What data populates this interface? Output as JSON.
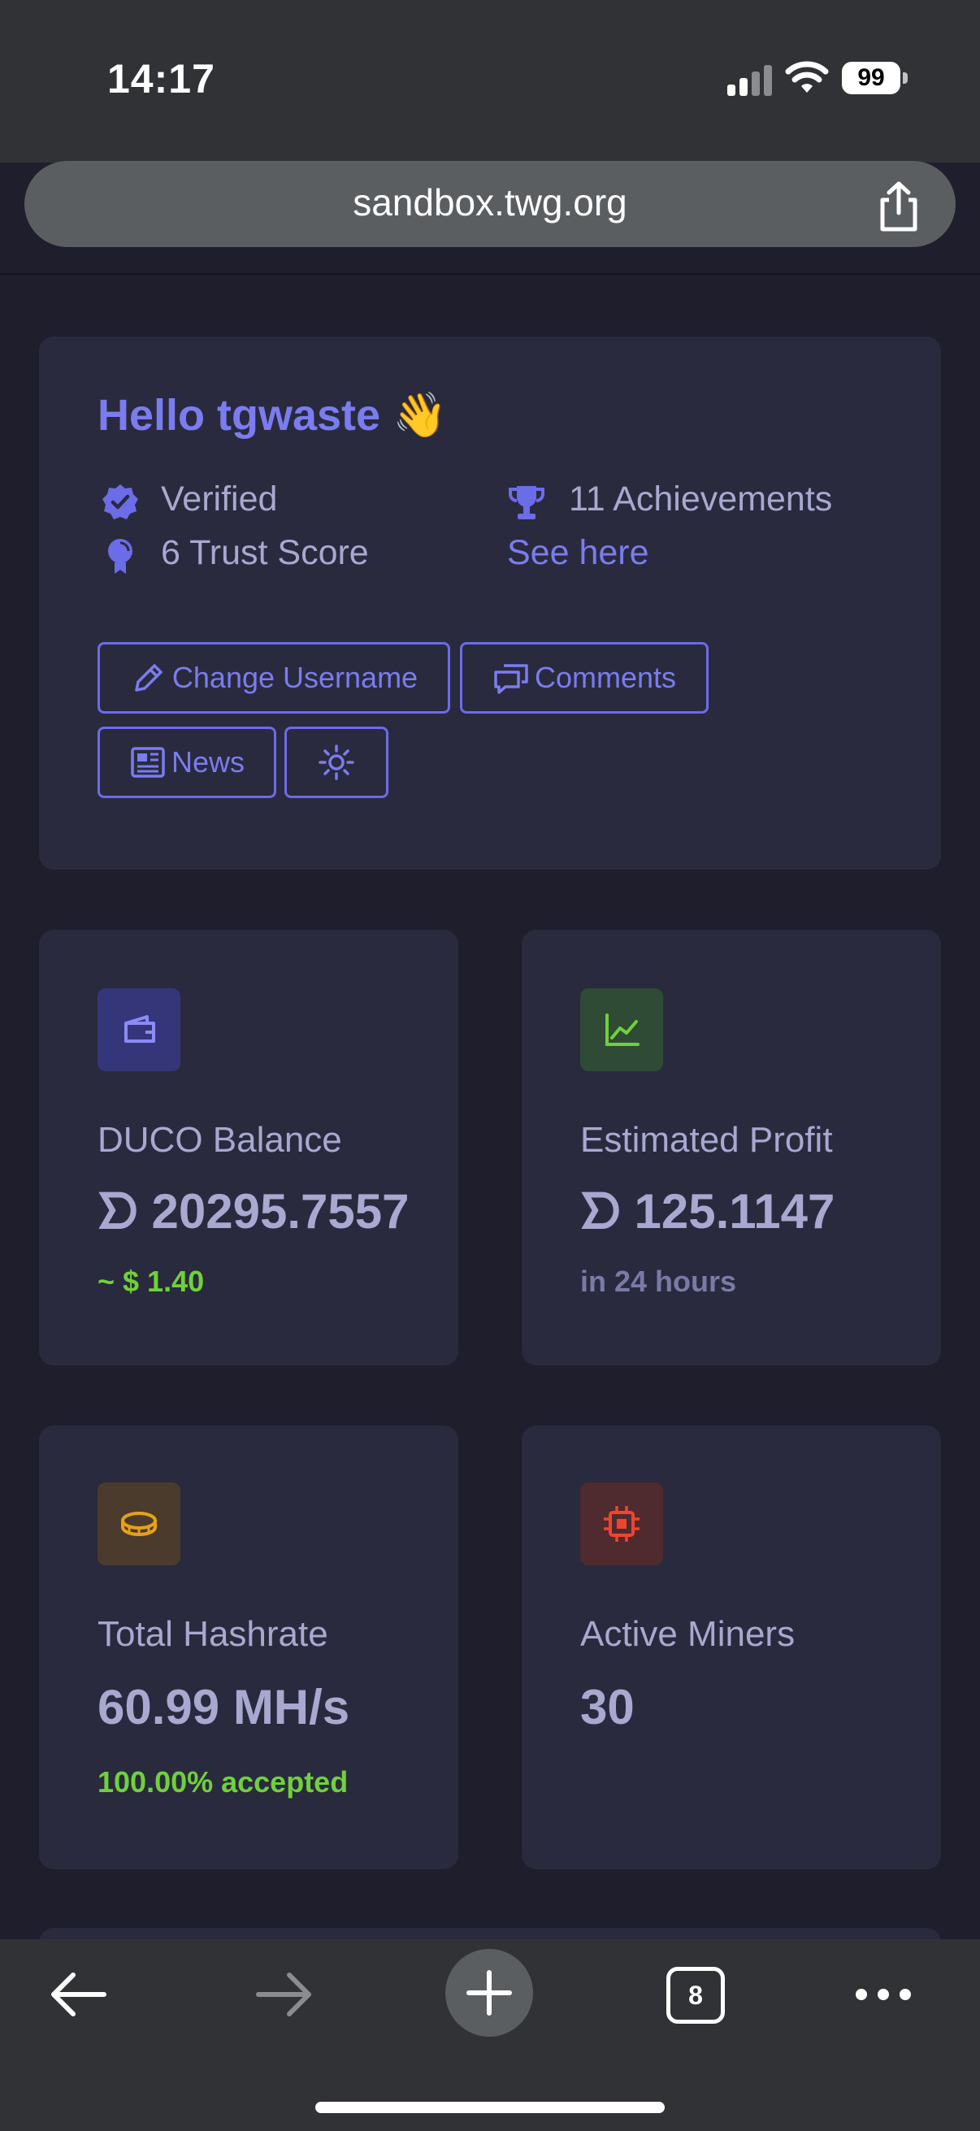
{
  "status_bar": {
    "time": "14:17",
    "battery": "99"
  },
  "browser": {
    "url": "sandbox.twg.org",
    "tab_count": "8"
  },
  "welcome": {
    "greeting": "Hello tgwaste",
    "wave_emoji": "👋",
    "verified": "Verified",
    "trust_score": "6 Trust Score",
    "achievements": "11 Achievements",
    "see_here": "See here",
    "buttons": {
      "change_username": "Change Username",
      "comments": "Comments",
      "news": "News"
    }
  },
  "tiles": {
    "balance": {
      "label": "DUCO Balance",
      "value": "ᗤ 20295.7557",
      "sub": "~ $ 1.40"
    },
    "profit": {
      "label": "Estimated Profit",
      "value": "ᗤ 125.1147",
      "sub": "in 24 hours"
    },
    "hashrate": {
      "label": "Total Hashrate",
      "value": "60.99 MH/s",
      "sub": "100.00% accepted"
    },
    "miners": {
      "label": "Active Miners",
      "value": "30"
    }
  },
  "colors": {
    "accent": "#7b7cf0",
    "green": "#6fd13b",
    "orange": "#e8a019",
    "red": "#f0452d"
  },
  "icons": [
    "share-icon",
    "verified-badge-icon",
    "trust-score-icon",
    "trophy-icon",
    "pencil-icon",
    "comments-icon",
    "news-icon",
    "sun-icon",
    "wallet-icon",
    "chart-line-icon",
    "coin-icon",
    "cpu-icon",
    "back-arrow-icon",
    "forward-arrow-icon",
    "plus-icon",
    "more-icon"
  ]
}
